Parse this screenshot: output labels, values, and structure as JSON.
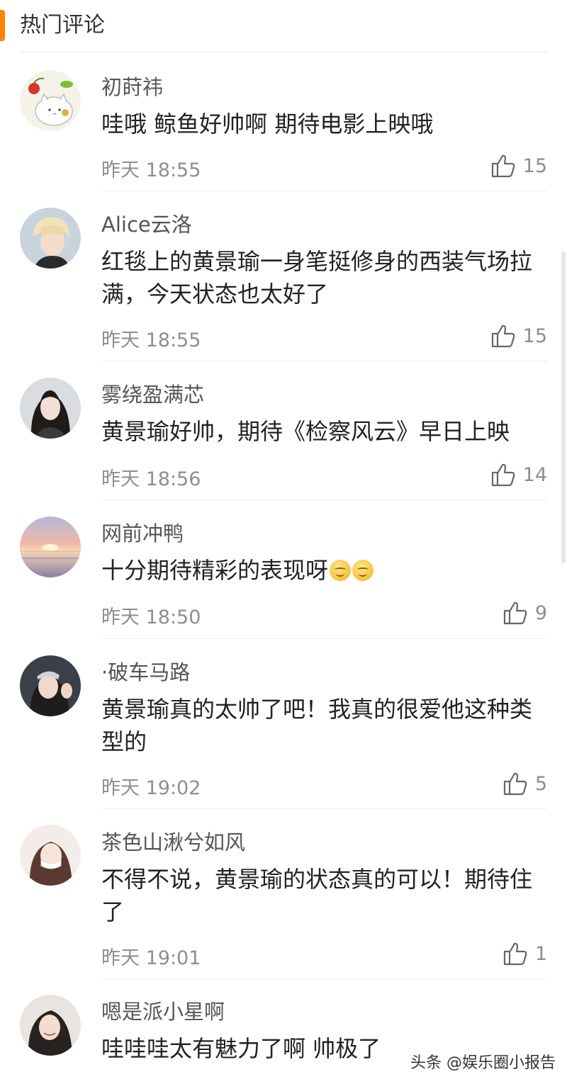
{
  "header": {
    "title": "热门评论"
  },
  "comments": [
    {
      "username": "初莳祎",
      "text": "哇哦 鲸鱼好帅啊 期待电影上映哦",
      "time": "昨天 18:55",
      "likes": "15",
      "avatar": "cat-cartoon-avatar"
    },
    {
      "username": "Alice云洛",
      "text": "红毯上的黄景瑜一身笔挺修身的西装气场拉满，今天状态也太好了",
      "time": "昨天 18:55",
      "likes": "15",
      "avatar": "blond-person-avatar"
    },
    {
      "username": "雾绕盈满芯",
      "text": "黄景瑜好帅，期待《检察风云》早日上映",
      "time": "昨天 18:56",
      "likes": "14",
      "avatar": "dark-hair-woman-avatar"
    },
    {
      "username": "网前冲鸭",
      "text": "十分期待精彩的表现呀",
      "time": "昨天 18:50",
      "likes": "9",
      "avatar": "sunset-sea-avatar",
      "emoji": [
        "smile-emoji",
        "smile-emoji"
      ]
    },
    {
      "username": "·破车马路",
      "text": "黄景瑜真的太帅了吧！我真的很爱他这种类型的",
      "time": "昨天 19:02",
      "likes": "5",
      "avatar": "woman-waving-avatar"
    },
    {
      "username": "茶色山湫兮如风",
      "text": "不得不说，黄景瑜的状态真的可以！期待住了",
      "time": "昨天 19:01",
      "likes": "1",
      "avatar": "woman-mask-avatar"
    },
    {
      "username": "嗯是派小星啊",
      "text": "哇哇哇太有魅力了啊 帅极了",
      "time": "",
      "likes": "",
      "avatar": "smiling-woman-avatar"
    }
  ],
  "watermark": "头条 @娱乐圈小报告",
  "colors": {
    "accent": "#ff8200",
    "text": "#222222",
    "meta": "#8e8e8e"
  }
}
